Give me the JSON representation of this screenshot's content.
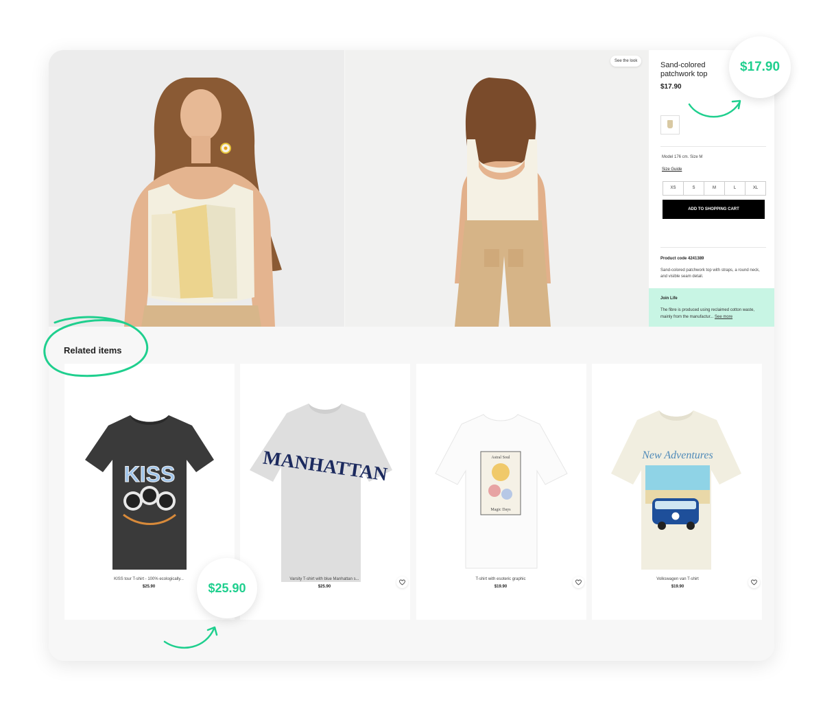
{
  "product": {
    "title": "Sand-colored patchwork top",
    "price": "$17.90",
    "see_look_label": "See the look",
    "model_info": "Model 176 cm. Size M",
    "size_guide_label": "Size Guide",
    "sizes": [
      "XS",
      "S",
      "M",
      "L",
      "XL"
    ],
    "add_to_cart_label": "ADD TO SHOPPING CART",
    "product_code_label": "Product code 4241389",
    "description": "Sand-colored patchwork top with straps, a round neck, and visible seam detail.",
    "join_life_title": "Join Life",
    "join_life_text": "The fibre is produced using reclaimed cotton waste, mainly from the manufactur...",
    "join_life_more": "See more"
  },
  "related": {
    "title": "Related items",
    "items": [
      {
        "name": "KISS tour T-shirt - 100% ecologically...",
        "price": "$25.90",
        "icon": "kiss-tshirt-image"
      },
      {
        "name": "Varsity T-shirt with blue Manhattan s...",
        "price": "$25.90",
        "icon": "manhattan-tshirt-image"
      },
      {
        "name": "T-shirt with esoteric graphic",
        "price": "$19.90",
        "icon": "esoteric-tshirt-image"
      },
      {
        "name": "Volkswagen van T-shirt",
        "price": "$19.90",
        "icon": "volkswagen-tshirt-image"
      }
    ]
  },
  "callouts": {
    "top_price": "$17.90",
    "bottom_price": "$25.90"
  },
  "graphics": {
    "kiss_text": "KISS",
    "manhattan_text": "MANHATTAN",
    "new_adventures_text": "New Adventures",
    "astral_soul_text": "Astral Soul",
    "magic_days_text": "Magic Days"
  },
  "colors": {
    "accent": "#1fcf8e",
    "join_life_bg": "#c8f5e4",
    "cart_button": "#000000",
    "manhattan_text": "#1c2a5e"
  }
}
